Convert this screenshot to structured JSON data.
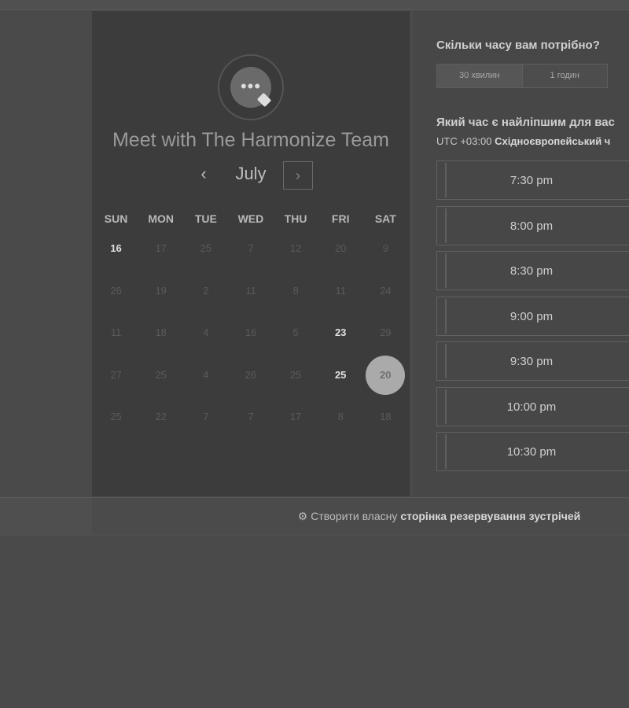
{
  "page": {
    "title": "Meet with The Harmonize Team"
  },
  "calendar": {
    "month": "July",
    "prev_icon": "‹",
    "next_icon": "›",
    "weekdays": [
      "SUN",
      "MON",
      "TUE",
      "WED",
      "THU",
      "FRI",
      "SAT"
    ],
    "weeks": [
      [
        {
          "d": "16",
          "s": "available"
        },
        {
          "d": "17",
          "s": "muted"
        },
        {
          "d": "25",
          "s": "muted"
        },
        {
          "d": "7",
          "s": "muted"
        },
        {
          "d": "12",
          "s": "muted"
        },
        {
          "d": "20",
          "s": "muted"
        },
        {
          "d": "9",
          "s": "muted"
        }
      ],
      [
        {
          "d": "26",
          "s": "muted"
        },
        {
          "d": "19",
          "s": "muted"
        },
        {
          "d": "2",
          "s": "muted"
        },
        {
          "d": "11",
          "s": "muted"
        },
        {
          "d": "8",
          "s": "muted"
        },
        {
          "d": "11",
          "s": "muted"
        },
        {
          "d": "24",
          "s": "muted"
        }
      ],
      [
        {
          "d": "11",
          "s": "muted"
        },
        {
          "d": "18",
          "s": "muted"
        },
        {
          "d": "4",
          "s": "muted"
        },
        {
          "d": "16",
          "s": "muted"
        },
        {
          "d": "5",
          "s": "muted"
        },
        {
          "d": "23",
          "s": "available"
        },
        {
          "d": "29",
          "s": "muted"
        }
      ],
      [
        {
          "d": "27",
          "s": "muted"
        },
        {
          "d": "25",
          "s": "muted"
        },
        {
          "d": "4",
          "s": "muted"
        },
        {
          "d": "26",
          "s": "muted"
        },
        {
          "d": "25",
          "s": "muted"
        },
        {
          "d": "25",
          "s": "available"
        },
        {
          "d": "20",
          "s": "selected"
        }
      ],
      [
        {
          "d": "25",
          "s": "muted"
        },
        {
          "d": "22",
          "s": "muted"
        },
        {
          "d": "7",
          "s": "muted"
        },
        {
          "d": "7",
          "s": "muted"
        },
        {
          "d": "17",
          "s": "muted"
        },
        {
          "d": "8",
          "s": "muted"
        },
        {
          "d": "18",
          "s": "muted"
        }
      ]
    ]
  },
  "duration": {
    "question": "Скільки часу вам потрібно?",
    "options": [
      "30 хвилин",
      "1 годин"
    ]
  },
  "times": {
    "question": "Який час є найліпшим для вас",
    "timezone_prefix": "UTC +03:00",
    "timezone_name": "Східноєвропейський ч",
    "slots": [
      "7:30 pm",
      "8:00 pm",
      "8:30 pm",
      "9:00 pm",
      "9:30 pm",
      "10:00 pm",
      "10:30 pm"
    ]
  },
  "footer": {
    "icon": "hubspot-sprocket-icon",
    "text": "Створити власну",
    "link": "сторінка резервування зустрічей"
  },
  "colors": {
    "background": "#4a4a4a",
    "left_panel": "#3c3c3c",
    "selected_day": "#aaaaaa"
  }
}
